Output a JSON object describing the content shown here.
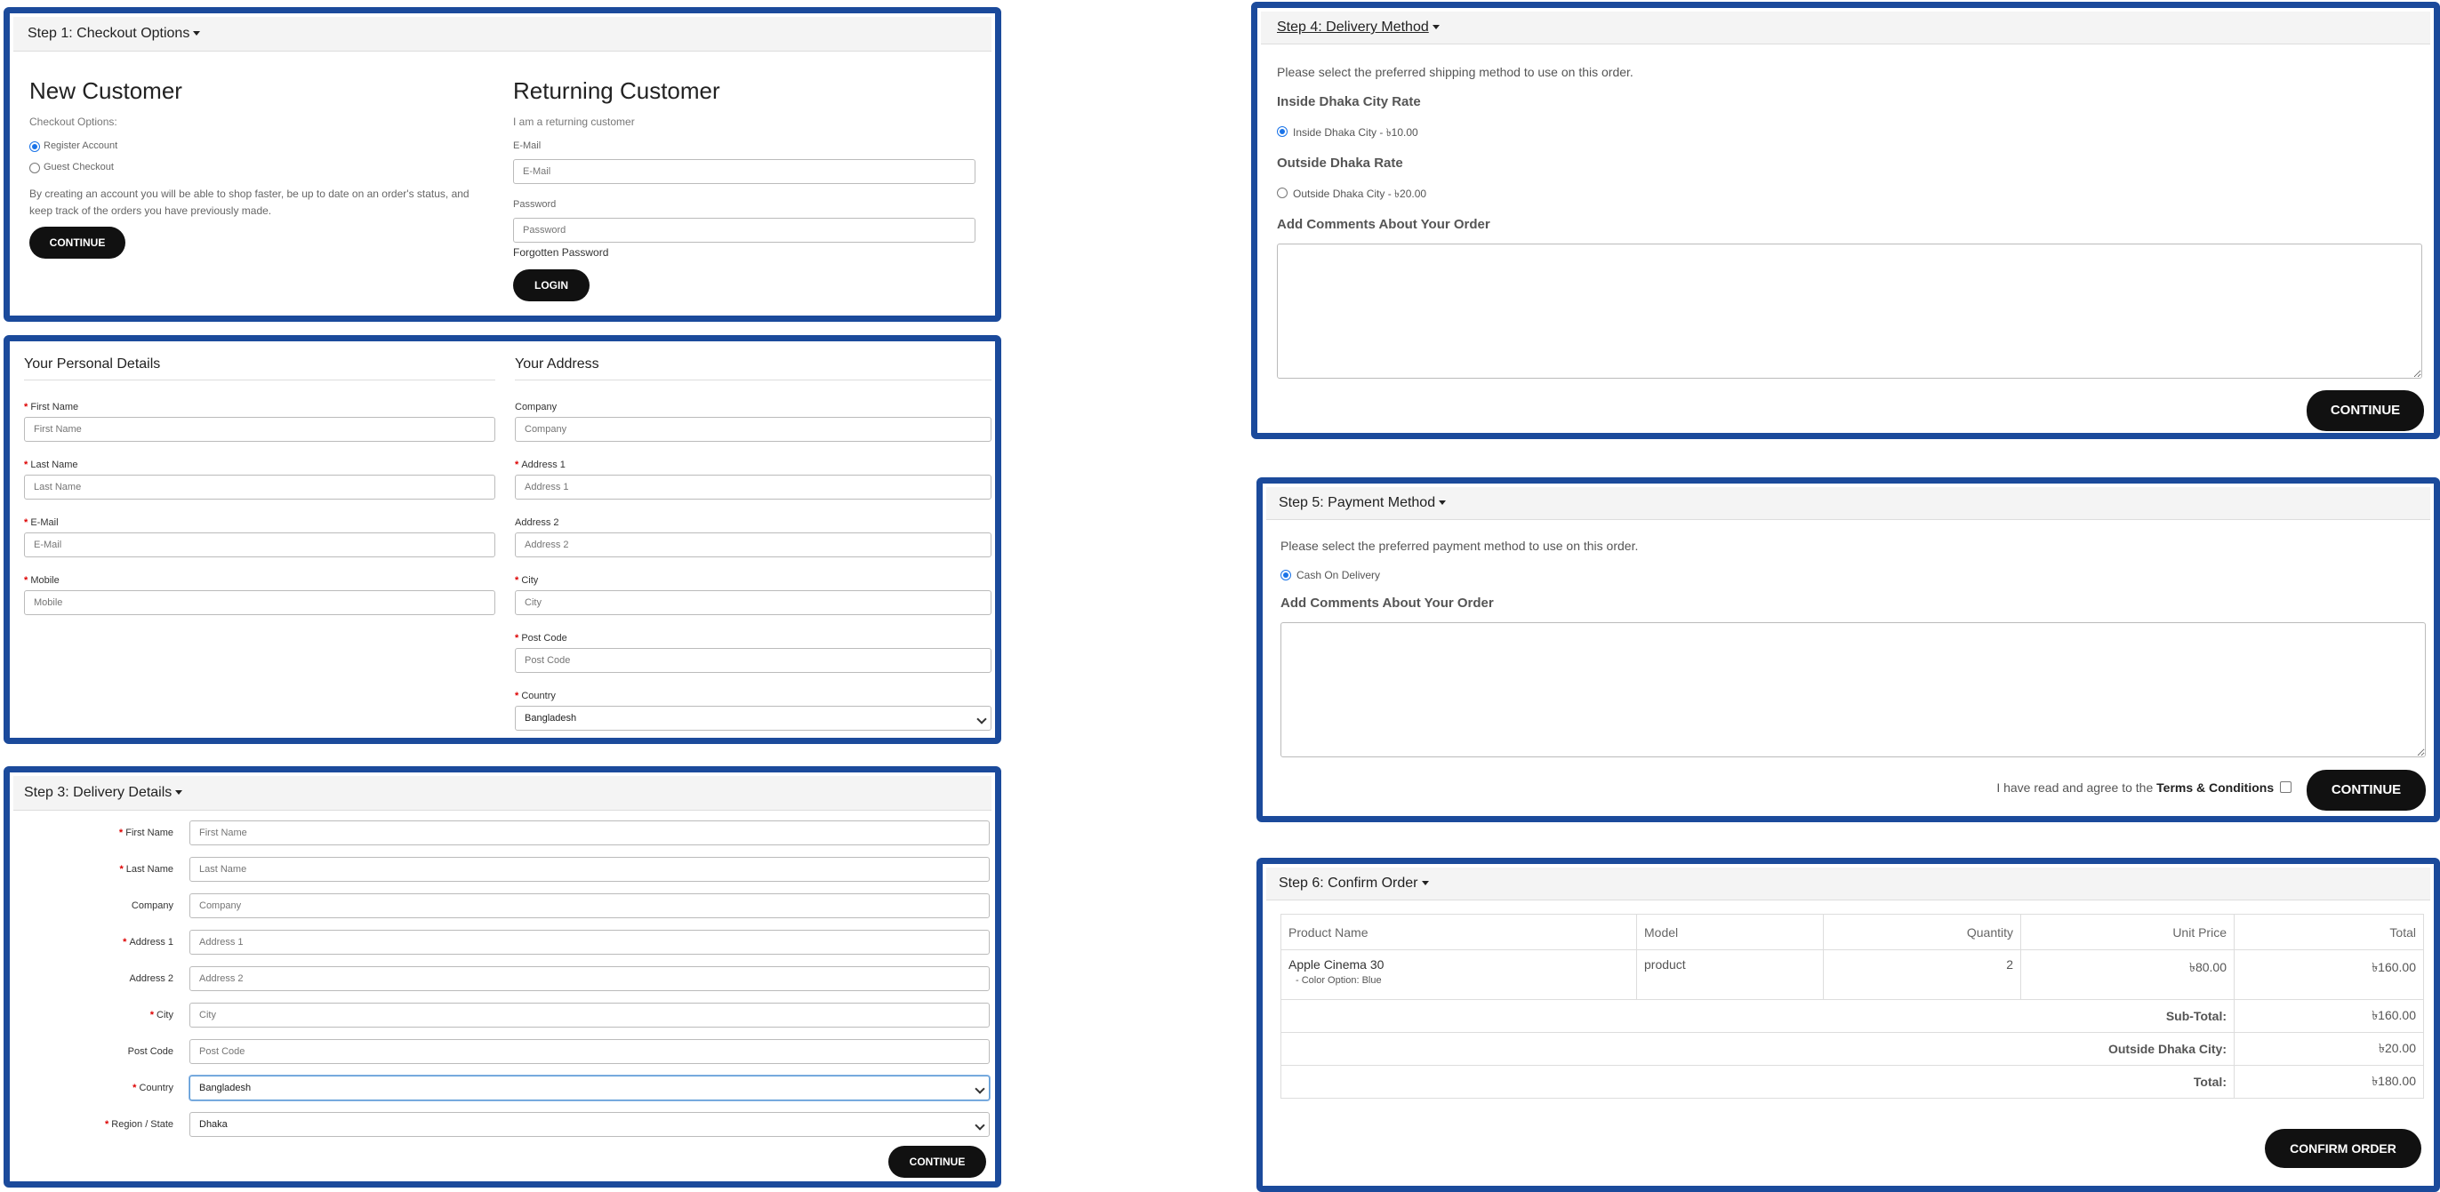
{
  "step1": {
    "title": "Step 1: Checkout Options",
    "new_customer": {
      "heading": "New Customer",
      "options_label": "Checkout Options:",
      "register": "Register Account",
      "guest": "Guest Checkout",
      "desc1": "By creating an account you will be able to shop faster, be up to date on an order's status, and",
      "desc2": "keep track of the orders you have previously made.",
      "continue": "CONTINUE"
    },
    "returning": {
      "heading": "Returning Customer",
      "sub": "I am a returning customer",
      "email_label": "E-Mail",
      "email_placeholder": "E-Mail",
      "password_label": "Password",
      "password_placeholder": "Password",
      "forgot": "Forgotten Password",
      "login": "LOGIN"
    }
  },
  "step2": {
    "personal_title": "Your Personal Details",
    "address_title": "Your Address",
    "first_name_label": "First Name",
    "first_name_ph": "First Name",
    "last_name_label": "Last Name",
    "last_name_ph": "Last Name",
    "email_label": "E-Mail",
    "email_ph": "E-Mail",
    "mobile_label": "Mobile",
    "mobile_ph": "Mobile",
    "company_label": "Company",
    "company_ph": "Company",
    "address1_label": "Address 1",
    "address1_ph": "Address 1",
    "address2_label": "Address 2",
    "address2_ph": "Address 2",
    "city_label": "City",
    "city_ph": "City",
    "postcode_label": "Post Code",
    "postcode_ph": "Post Code",
    "country_label": "Country",
    "country_value": "Bangladesh"
  },
  "step3": {
    "title": "Step 3: Delivery Details",
    "first_name_label": "First Name",
    "first_name_ph": "First Name",
    "last_name_label": "Last Name",
    "last_name_ph": "Last Name",
    "company_label": "Company",
    "company_ph": "Company",
    "address1_label": "Address 1",
    "address1_ph": "Address 1",
    "address2_label": "Address 2",
    "address2_ph": "Address 2",
    "city_label": "City",
    "city_ph": "City",
    "postcode_label": "Post Code",
    "postcode_ph": "Post Code",
    "country_label": "Country",
    "country_value": "Bangladesh",
    "region_label": "Region / State",
    "region_value": "Dhaka",
    "continue": "CONTINUE"
  },
  "step4": {
    "title": "Step 4: Delivery Method",
    "intro": "Please select the preferred shipping method to use on this order.",
    "inside_heading": "Inside Dhaka City Rate",
    "inside_option": "Inside Dhaka City - ৳10.00",
    "outside_heading": "Outside Dhaka Rate",
    "outside_option": "Outside Dhaka City - ৳20.00",
    "comments_label": "Add Comments About Your Order",
    "continue": "CONTINUE"
  },
  "step5": {
    "title": "Step 5: Payment Method",
    "intro": "Please select the preferred payment method to use on this order.",
    "cod": "Cash On Delivery",
    "comments_label": "Add Comments About Your Order",
    "agree_prefix": "I have read and agree to the",
    "terms": "Terms & Conditions",
    "continue": "CONTINUE"
  },
  "step6": {
    "title": "Step 6: Confirm Order",
    "headers": [
      "Product Name",
      "Model",
      "Quantity",
      "Unit Price",
      "Total"
    ],
    "product": {
      "name": "Apple Cinema 30",
      "option": "- Color Option: Blue",
      "model": "product",
      "quantity": "2",
      "unit_price": "৳80.00",
      "total": "৳160.00"
    },
    "subtotal_label": "Sub-Total:",
    "subtotal": "৳160.00",
    "shipping_label": "Outside Dhaka City:",
    "shipping": "৳20.00",
    "total_label": "Total:",
    "total": "৳180.00",
    "confirm": "CONFIRM ORDER"
  }
}
